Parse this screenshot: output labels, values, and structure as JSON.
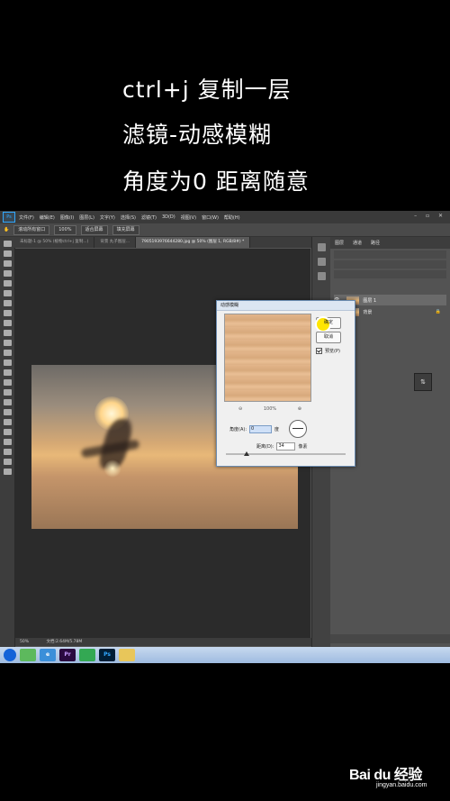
{
  "captions": {
    "line1": "ctrl+j 复制一层",
    "line2": "滤镜-动感模糊",
    "line3": "角度为0 距离随意"
  },
  "photoshop": {
    "menu": [
      "文件(F)",
      "编辑(E)",
      "图像(I)",
      "图层(L)",
      "文字(Y)",
      "选择(S)",
      "滤镜(T)",
      "3D(D)",
      "视图(V)",
      "窗口(W)",
      "帮助(H)"
    ],
    "options": {
      "scroll_all": "滚动所有窗口",
      "zoom": "100%",
      "fit_screen": "适合屏幕",
      "fill_screen": "填充屏幕"
    },
    "tabs": [
      "未标题-1 @ 50% (植物ctrl+j 复制...)",
      "背景 丸子图层...",
      "7905193976644280.jpg @ 50% (图层 1, RGB/8#) *"
    ],
    "status": {
      "zoom": "50%",
      "doc": "文档:2.64M/5.78M"
    },
    "layers_panel": {
      "tabs": [
        "图层",
        "通道",
        "路径"
      ],
      "layer1": "图层 1",
      "layer2": "背景"
    }
  },
  "dialog": {
    "title": "动感模糊",
    "ok": "确定",
    "cancel": "取消",
    "preview_label": "预览(P)",
    "zoom_value": "100%",
    "zoom_out": "⊖",
    "zoom_in": "⊕",
    "angle_label": "角度(A):",
    "angle_value": "0",
    "angle_unit": "度",
    "distance_label": "距离(D):",
    "distance_value": "34",
    "distance_unit": "像素"
  },
  "taskbar": {
    "ie": "e",
    "pr": "Pr",
    "ps": "Ps"
  },
  "watermark": {
    "brand": "Bai du 经验",
    "url": "jingyan.baidu.com"
  }
}
